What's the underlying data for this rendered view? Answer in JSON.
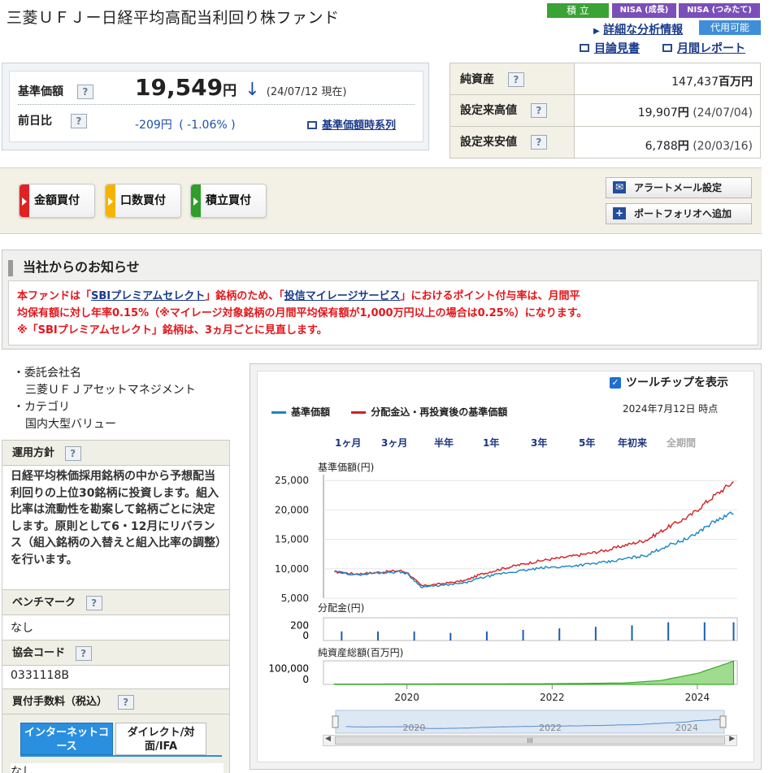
{
  "fund": {
    "title": "三菱ＵＦＪー日経平均高配当利回り株ファンド"
  },
  "badges": {
    "tsumitate": "積 立",
    "nisa_seicho": "NISA (成長)",
    "nisa_tsumitate": "NISA (つみたて)",
    "daiyo": "代用可能"
  },
  "links": {
    "analysis": "詳細な分析情報",
    "mokuromi": "目論見書",
    "monthly": "月間レポート",
    "nav_series": "基準価額時系列"
  },
  "price": {
    "label": "基準価額",
    "value": "19,549",
    "unit": "円",
    "arrow": "↓",
    "date": "(24/07/12 現在)",
    "change_label": "前日比",
    "change_value": "-209円",
    "change_pct": "( -1.06% )",
    "help": "?"
  },
  "stats": [
    {
      "label": "純資産",
      "value": "147,437",
      "unit": "百万円",
      "date": ""
    },
    {
      "label": "設定来高値",
      "value": "19,907",
      "unit": "円",
      "date": "(24/07/04)"
    },
    {
      "label": "設定来安値",
      "value": "6,788",
      "unit": "円",
      "date": "(20/03/16)"
    }
  ],
  "buy_buttons": {
    "amount": "金額買付",
    "units": "口数買付",
    "tsumitate": "積立買付"
  },
  "side_buttons": {
    "alert": "アラートメール設定",
    "portfolio": "ポートフォリオへ追加"
  },
  "notice": {
    "title": "当社からのお知らせ",
    "line1_a": "本ファンドは「",
    "line1_link1": "SBIプレミアムセレクト",
    "line1_b": "」銘柄のため、「",
    "line1_link2": "投信マイレージサービス",
    "line1_c": "」におけるポイント付与率は、月間平",
    "line2": "均保有額に対し年率0.15%（※マイレージ対象銘柄の月間平均保有額が1,000万円以上の場合は0.25%）になります。",
    "line3": "※「SBIプレミアムセレクト」銘柄は、3ヵ月ごとに見直します。"
  },
  "info": {
    "company_label": "・委託会社名",
    "company": "三菱ＵＦＪアセットマネジメント",
    "category_label": "・カテゴリ",
    "category": "国内大型バリュー",
    "policy_label": "運用方針",
    "policy": "日経平均株価採用銘柄の中から予想配当利回りの上位30銘柄に投資します。組入比率は流動性を勘案して銘柄ごとに決定します。原則として6・12月にリバランス（組入銘柄の入替えと組入比率の調整）を行います。",
    "benchmark_label": "ベンチマーク",
    "benchmark": "なし",
    "code_label": "協会コード",
    "code": "0331118B",
    "fee_label": "買付手数料（税込）",
    "tab_internet": "インターネットコース",
    "tab_direct": "ダイレクト/対面/IFA",
    "fee_value": "なし"
  },
  "chart_panel": {
    "tooltip_label": "ツールチップを表示",
    "legend1": "基準価額",
    "legend2": "分配金込・再投資後の基準価額",
    "asof": "2024年7月12日 時点",
    "periods": [
      "1ヶ月",
      "3ヶ月",
      "半年",
      "1年",
      "3年",
      "5年",
      "年初来",
      "全期間"
    ],
    "axis_price": "基準価額(円)",
    "axis_div": "分配金(円)",
    "axis_assets": "純資産総額(百万円)",
    "scrollbar_grip": "III"
  },
  "chart_data": [
    {
      "type": "line",
      "ylabel": "基準価額(円)",
      "ylim": [
        5000,
        26000
      ],
      "yticks": [
        "25,000",
        "20,000",
        "15,000",
        "10,000",
        "5,000"
      ],
      "x": [
        2019.0,
        2019.3,
        2019.6,
        2019.9,
        2020.0,
        2020.2,
        2020.5,
        2020.8,
        2021.0,
        2021.3,
        2021.6,
        2021.9,
        2022.2,
        2022.5,
        2022.8,
        2023.0,
        2023.3,
        2023.6,
        2023.9,
        2024.2,
        2024.5
      ],
      "series": [
        {
          "name": "基準価額",
          "color": "#1a85c4",
          "values": [
            9500,
            9000,
            9300,
            9500,
            9200,
            6900,
            7200,
            7600,
            8400,
            9200,
            9700,
            10200,
            10400,
            10800,
            11200,
            11700,
            12300,
            14000,
            15300,
            17800,
            19549
          ]
        },
        {
          "name": "分配金込・再投資後の基準価額",
          "color": "#d31f23",
          "values": [
            9500,
            9100,
            9400,
            9700,
            9400,
            7100,
            7500,
            8000,
            9000,
            10000,
            10800,
            11500,
            12000,
            12600,
            13300,
            14000,
            14900,
            17100,
            19000,
            22100,
            24800
          ]
        }
      ]
    },
    {
      "type": "bar",
      "ylabel": "分配金(円)",
      "ylim": [
        0,
        300
      ],
      "yticks": [
        "200",
        "0"
      ],
      "x": [
        2019.1,
        2019.6,
        2020.1,
        2020.6,
        2021.1,
        2021.6,
        2022.1,
        2022.6,
        2023.1,
        2023.6,
        2024.1,
        2024.5
      ],
      "values": [
        120,
        120,
        120,
        100,
        120,
        140,
        160,
        180,
        200,
        240,
        240,
        240
      ]
    },
    {
      "type": "area",
      "ylabel": "純資産総額(百万円)",
      "ylim": [
        0,
        150000
      ],
      "yticks": [
        "100,000",
        "0"
      ],
      "x": [
        2019.0,
        2020.0,
        2021.0,
        2022.0,
        2023.0,
        2023.5,
        2024.0,
        2024.5
      ],
      "values": [
        2000,
        2500,
        3500,
        4500,
        9000,
        25000,
        70000,
        147437
      ]
    }
  ],
  "xaxis": {
    "labels": [
      "2020",
      "2022",
      "2024"
    ]
  }
}
